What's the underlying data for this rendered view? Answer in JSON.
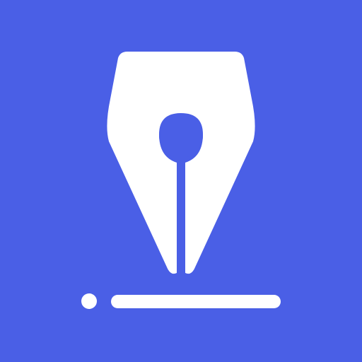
{
  "icon": {
    "name": "fountain-pen-nib-icon",
    "background_color": "#4A5FE6",
    "foreground_color": "#FFFFFF"
  }
}
